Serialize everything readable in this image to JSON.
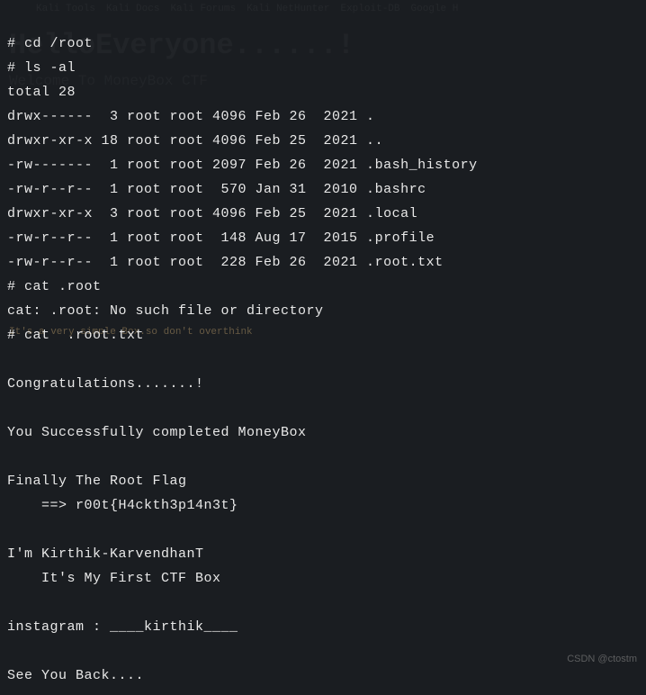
{
  "ghost": {
    "tabs": [
      "Kali Tools",
      "Kali Docs",
      "Kali Forums",
      "Kali NetHunter",
      "Exploit-DB",
      "Google H"
    ],
    "title": "HelloEveryone......!",
    "sub": "Welcome To MoneyBox CTF",
    "hint": "It's a very simple Box.so don't overthink"
  },
  "lines": {
    "l0": "# cd /root",
    "l1": "# ls -al",
    "l2": "total 28",
    "l3": "drwx------  3 root root 4096 Feb 26  2021 .",
    "l4": "drwxr-xr-x 18 root root 4096 Feb 25  2021 ..",
    "l5": "-rw-------  1 root root 2097 Feb 26  2021 .bash_history",
    "l6": "-rw-r--r--  1 root root  570 Jan 31  2010 .bashrc",
    "l7": "drwxr-xr-x  3 root root 4096 Feb 25  2021 .local",
    "l8": "-rw-r--r--  1 root root  148 Aug 17  2015 .profile",
    "l9": "-rw-r--r--  1 root root  228 Feb 26  2021 .root.txt",
    "l10": "# cat .root",
    "l11": "cat: .root: No such file or directory",
    "l12": "# cat  .root.txt",
    "l13": "",
    "l14": "Congratulations.......!",
    "l15": "",
    "l16": "You Successfully completed MoneyBox",
    "l17": "",
    "l18": "Finally The Root Flag",
    "l19": "    ==> r00t{H4ckth3p14n3t}",
    "l20": "",
    "l21": "I'm Kirthik-KarvendhanT",
    "l22": "    It's My First CTF Box",
    "l23": "",
    "l24": "instagram : ____kirthik____",
    "l25": "",
    "l26": "See You Back...."
  },
  "watermark": "CSDN @ctostm"
}
